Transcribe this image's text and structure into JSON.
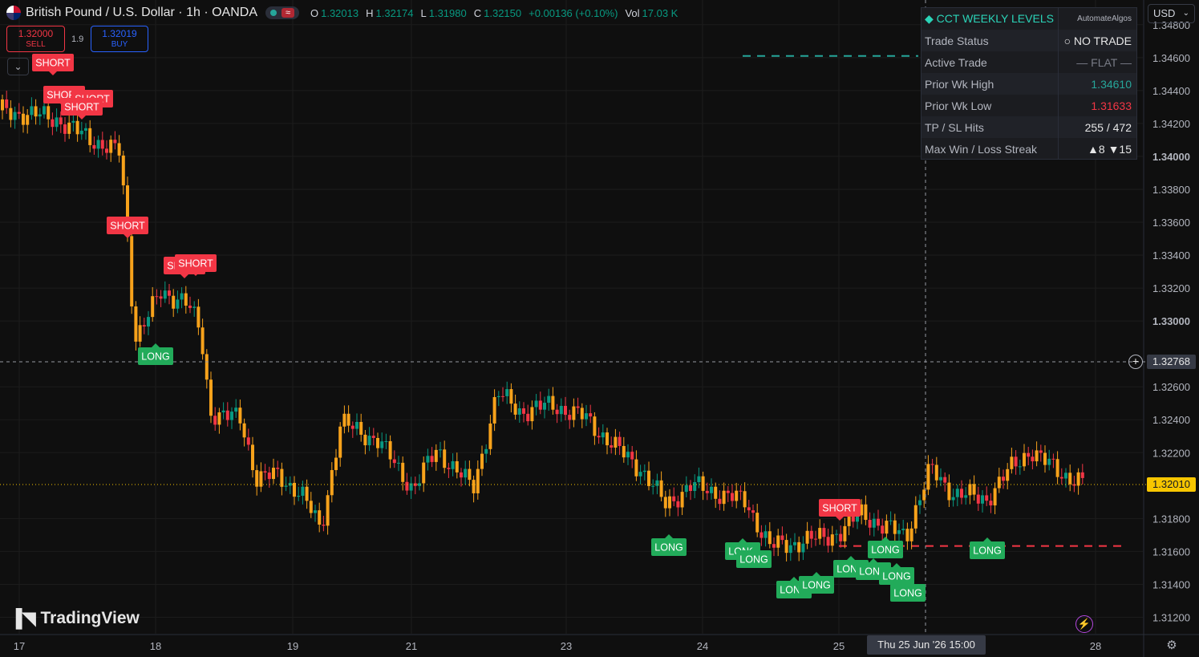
{
  "header": {
    "symbol_title": "British Pound / U.S. Dollar · 1h · OANDA",
    "ohlc": {
      "o_label": "O",
      "o": "1.32013",
      "h_label": "H",
      "h": "1.32174",
      "l_label": "L",
      "l": "1.31980",
      "c_label": "C",
      "c": "1.32150",
      "change": "+0.00136 (+0.10%)",
      "vol_label": "Vol",
      "vol": "17.03 K"
    }
  },
  "trade_panel": {
    "sell_price": "1.32000",
    "sell_label": "SELL",
    "spread": "1.9",
    "buy_price": "1.32019",
    "buy_label": "BUY"
  },
  "currency_button": "USD",
  "levels_table": {
    "title": "CCT WEEKLY LEVELS",
    "brand": "AutomateAlgos",
    "rows": [
      {
        "label": "Trade Status",
        "value": "○ NO TRADE",
        "color": "#e6e6e6"
      },
      {
        "label": "Active Trade",
        "value": "— FLAT —",
        "color": "#787b86"
      },
      {
        "label": "Prior Wk High",
        "value": "1.34610",
        "color": "#26a69a"
      },
      {
        "label": "Prior Wk Low",
        "value": "1.31633",
        "color": "#f23645"
      },
      {
        "label": "TP / SL Hits",
        "value": "255 / 472",
        "color": "#e6e6e6"
      },
      {
        "label": "Max Win / Loss Streak",
        "value": "▲8  ▼15",
        "color": "#e6e6e6"
      }
    ]
  },
  "branding": {
    "logo_text": "TradingView"
  },
  "crosshair": {
    "price": "1.32768",
    "date": "Thu 25 Jun '26   15:00"
  },
  "last_price": "1.32010",
  "chart_data": {
    "type": "candlestick",
    "y_axis": {
      "range": [
        1.311,
        1.3495
      ],
      "ticks": [
        "1.34800",
        "1.34600",
        "1.34400",
        "1.34200",
        "1.34000",
        "1.33800",
        "1.33600",
        "1.33400",
        "1.33200",
        "1.33000",
        "1.32600",
        "1.32400",
        "1.32200",
        "1.31800",
        "1.31600",
        "1.31400",
        "1.31200"
      ],
      "bold_ticks": [
        "1.34000",
        "1.33000"
      ]
    },
    "x_axis": {
      "ticks": [
        "17",
        "18",
        "19",
        "21",
        "23",
        "24",
        "25",
        "28"
      ]
    },
    "levels": {
      "prior_week_high": 1.3461,
      "prior_week_low": 1.31633
    },
    "candle_colors": {
      "up": "#089981",
      "down": "#f23645",
      "signal": "#f7a21b"
    },
    "signals": [
      {
        "label": "SHORT",
        "side": "short"
      },
      {
        "label": "SHORT",
        "side": "short"
      },
      {
        "label": "SHORT",
        "side": "short"
      },
      {
        "label": "SHORT",
        "side": "short"
      },
      {
        "label": "SHORT",
        "side": "short"
      },
      {
        "label": "SHORT",
        "side": "short"
      },
      {
        "label": "SHORT",
        "side": "short"
      },
      {
        "label": "SHORT",
        "side": "short"
      },
      {
        "label": "LONG",
        "side": "long"
      },
      {
        "label": "LONG",
        "side": "long"
      },
      {
        "label": "LONG",
        "side": "long"
      },
      {
        "label": "LONG",
        "side": "long"
      },
      {
        "label": "LONG",
        "side": "long"
      },
      {
        "label": "LONG",
        "side": "long"
      },
      {
        "label": "LONG",
        "side": "long"
      },
      {
        "label": "LONG",
        "side": "long"
      },
      {
        "label": "LONG",
        "side": "long"
      },
      {
        "label": "LONG",
        "side": "long"
      },
      {
        "label": "LONG",
        "side": "long"
      },
      {
        "label": "LONG",
        "side": "long"
      }
    ],
    "anchors": [
      [
        0,
        1.3428
      ],
      [
        70,
        1.3423
      ],
      [
        95,
        1.3415
      ],
      [
        150,
        1.3402
      ],
      [
        160,
        1.3343
      ],
      [
        168,
        1.329
      ],
      [
        200,
        1.3316
      ],
      [
        230,
        1.3314
      ],
      [
        250,
        1.3293
      ],
      [
        262,
        1.3245
      ],
      [
        300,
        1.324
      ],
      [
        320,
        1.3205
      ],
      [
        345,
        1.3206
      ],
      [
        375,
        1.3196
      ],
      [
        400,
        1.3173
      ],
      [
        425,
        1.3238
      ],
      [
        470,
        1.3228
      ],
      [
        515,
        1.3198
      ],
      [
        545,
        1.3222
      ],
      [
        590,
        1.3198
      ],
      [
        620,
        1.3256
      ],
      [
        650,
        1.3245
      ],
      [
        690,
        1.3249
      ],
      [
        730,
        1.3241
      ],
      [
        770,
        1.3222
      ],
      [
        800,
        1.321
      ],
      [
        830,
        1.3188
      ],
      [
        860,
        1.32
      ],
      [
        900,
        1.3195
      ],
      [
        930,
        1.319
      ],
      [
        960,
        1.3163
      ],
      [
        990,
        1.3165
      ],
      [
        1020,
        1.3168
      ],
      [
        1050,
        1.3172
      ],
      [
        1075,
        1.3184
      ],
      [
        1100,
        1.3175
      ],
      [
        1130,
        1.317
      ],
      [
        1160,
        1.321
      ],
      [
        1190,
        1.3195
      ],
      [
        1230,
        1.3192
      ],
      [
        1260,
        1.321
      ],
      [
        1285,
        1.3222
      ],
      [
        1300,
        1.3215
      ],
      [
        1330,
        1.3206
      ],
      [
        1352,
        1.3201
      ]
    ]
  }
}
